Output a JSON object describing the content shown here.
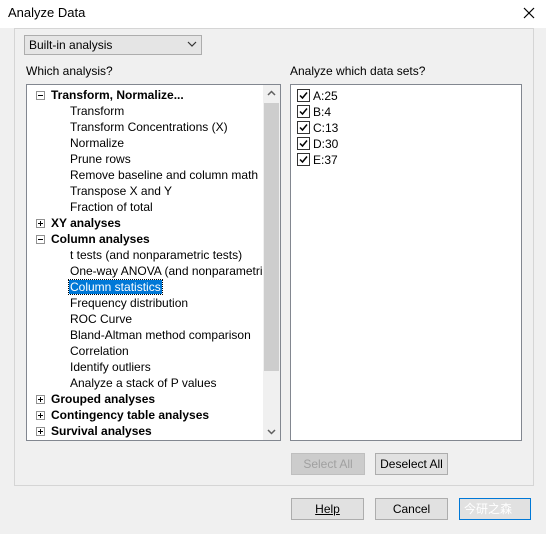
{
  "window": {
    "title": "Analyze Data"
  },
  "analysis_type_combo": {
    "value": "Built-in analysis"
  },
  "labels": {
    "which_analysis": "Which analysis?",
    "which_data_sets": "Analyze which data sets?"
  },
  "tree": {
    "groups": [
      {
        "label": "Transform, Normalize...",
        "expanded": true,
        "items": [
          "Transform",
          "Transform Concentrations (X)",
          "Normalize",
          "Prune rows",
          "Remove baseline and column math",
          "Transpose X and Y",
          "Fraction of total"
        ]
      },
      {
        "label": "XY analyses",
        "expanded": false,
        "items": []
      },
      {
        "label": "Column analyses",
        "expanded": true,
        "items": [
          "t tests (and nonparametric tests)",
          "One-way ANOVA (and nonparametric)",
          "Column statistics",
          "Frequency distribution",
          "ROC Curve",
          "Bland-Altman method comparison",
          "Correlation",
          "Identify outliers",
          "Analyze a stack of P values"
        ]
      },
      {
        "label": "Grouped analyses",
        "expanded": false,
        "items": []
      },
      {
        "label": "Contingency table analyses",
        "expanded": false,
        "items": []
      },
      {
        "label": "Survival analyses",
        "expanded": false,
        "items": []
      }
    ],
    "selected_item": "Column statistics"
  },
  "data_sets": [
    {
      "label": "A:25",
      "checked": true
    },
    {
      "label": "B:4",
      "checked": true
    },
    {
      "label": "C:13",
      "checked": true
    },
    {
      "label": "D:30",
      "checked": true
    },
    {
      "label": "E:37",
      "checked": true
    }
  ],
  "buttons": {
    "select_all": "Select All",
    "deselect_all": "Deselect All",
    "help": "Help",
    "cancel": "Cancel",
    "ok_watermark": "今研之森"
  },
  "colors": {
    "selection": "#0078d7",
    "background": "#f0f0f0"
  }
}
